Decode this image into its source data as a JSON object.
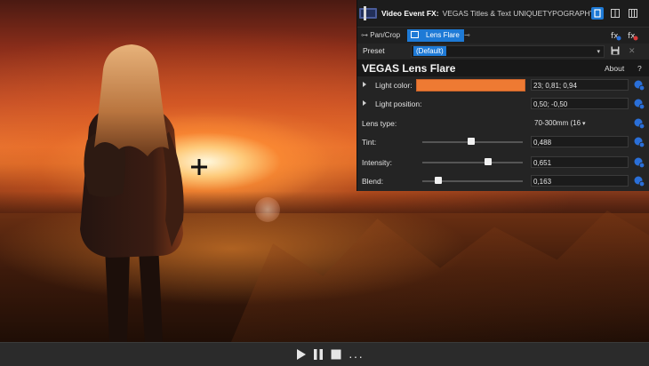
{
  "window": {
    "title_prefix": "Video Event FX:",
    "title_detail": "VEGAS Titles & Text UNIQUETYPOGRAPHY"
  },
  "tabs": [
    {
      "label": "Pan/Crop"
    },
    {
      "label": "Lens Flare",
      "active": true
    }
  ],
  "preset": {
    "label": "Preset",
    "value": "(Default)"
  },
  "plugin": {
    "title": "VEGAS Lens Flare",
    "about_label": "About",
    "help_label": "?"
  },
  "params": {
    "light_color": {
      "label": "Light color:",
      "value": "23; 0,81; 0,94",
      "swatch": "#ee7a33"
    },
    "light_position": {
      "label": "Light position:",
      "value": "0,50; -0,50"
    },
    "lens_type": {
      "label": "Lens type:",
      "value": "70-300mm (16"
    },
    "tint": {
      "label": "Tint:",
      "value": "0,488",
      "level": 0.488
    },
    "intensity": {
      "label": "Intensity:",
      "value": "0,651",
      "level": 0.651
    },
    "blend": {
      "label": "Blend:",
      "value": "0,163",
      "level": 0.163
    }
  },
  "colors": {
    "accent": "#1e7ad6",
    "panel_bg": "#242424",
    "keyframe_blue": "#2a6fd8"
  },
  "icons": {
    "play": "play-icon",
    "pause": "pause-icon",
    "stop": "stop-icon",
    "more": "more-icon"
  },
  "transport": {
    "more_label": "···"
  }
}
